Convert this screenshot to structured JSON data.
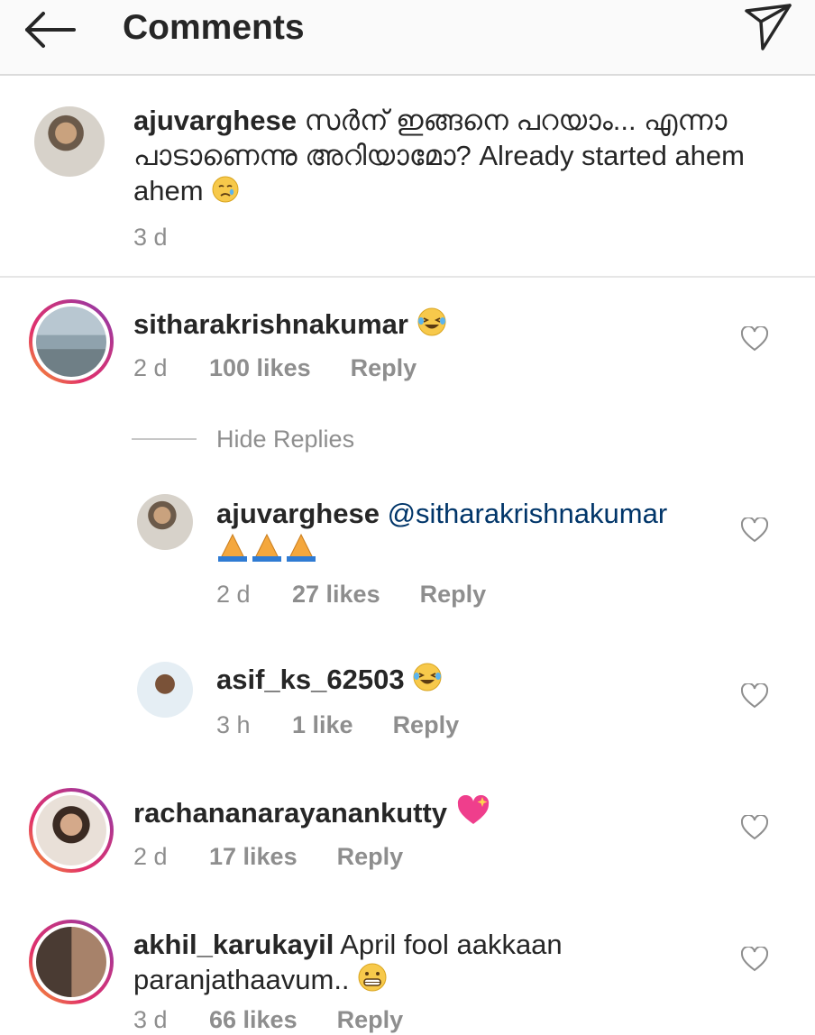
{
  "header": {
    "title": "Comments"
  },
  "caption": {
    "username": "ajuvarghese",
    "text": "സർന് ഇങ്ങനെ പറയാം... എന്നാ പാടാണെന്നു അറിയാമോ? Already started ahem ahem",
    "emoji": "crying-face",
    "time": "3 d"
  },
  "comments": [
    {
      "username": "sitharakrishnakumar",
      "text": "",
      "emoji": "laughing-tears",
      "time": "2 d",
      "likes": "100 likes",
      "reply": "Reply"
    },
    {
      "username": "ajuvarghese",
      "mention": "@sitharakrishnakumar",
      "emoji": "folded-hands x3",
      "time": "2 d",
      "likes": "27 likes",
      "reply": "Reply"
    },
    {
      "username": "asif_ks_62503",
      "text": "",
      "emoji": "laughing-tears",
      "time": "3 h",
      "likes": "1 like",
      "reply": "Reply"
    },
    {
      "username": "rachananarayanankutty",
      "text": "",
      "emoji": "sparkling-heart",
      "time": "2 d",
      "likes": "17 likes",
      "reply": "Reply"
    },
    {
      "username": "akhil_karukayil",
      "text": "April fool aakkaan paranjathaavum..",
      "emoji": "grimacing-face",
      "time": "3 d",
      "likes": "66 likes",
      "reply": "Reply"
    }
  ],
  "hide_replies": "Hide Replies",
  "colors": {
    "text": "#262626",
    "secondary": "#8e8e8e",
    "mention": "#003569",
    "divider": "#dbdbdb"
  }
}
